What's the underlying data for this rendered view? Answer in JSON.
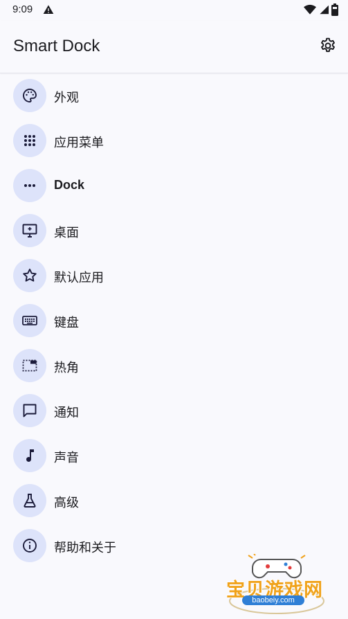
{
  "status_bar": {
    "time": "9:09",
    "icons": [
      "warning-icon",
      "wifi-icon",
      "signal-icon",
      "battery-icon"
    ]
  },
  "app_bar": {
    "title": "Smart Dock",
    "settings_icon": "gear-icon"
  },
  "menu": {
    "items": [
      {
        "label": "外观",
        "icon": "palette-icon"
      },
      {
        "label": "应用菜单",
        "icon": "apps-grid-icon"
      },
      {
        "label": "Dock",
        "icon": "more-horizontal-icon"
      },
      {
        "label": "桌面",
        "icon": "desktop-icon"
      },
      {
        "label": "默认应用",
        "icon": "star-icon"
      },
      {
        "label": "键盘",
        "icon": "keyboard-icon"
      },
      {
        "label": "热角",
        "icon": "hot-corner-icon"
      },
      {
        "label": "通知",
        "icon": "message-icon"
      },
      {
        "label": "声音",
        "icon": "music-note-icon"
      },
      {
        "label": "高级",
        "icon": "flask-icon"
      },
      {
        "label": "帮助和关于",
        "icon": "info-icon"
      }
    ]
  },
  "watermark": {
    "text": "宝贝游戏网",
    "url": "baobeiy.com"
  },
  "colors": {
    "background": "#f9f9fd",
    "icon_circle": "#dde3fa",
    "icon_stroke": "#1b1b3a",
    "text": "#1b1b1f"
  }
}
